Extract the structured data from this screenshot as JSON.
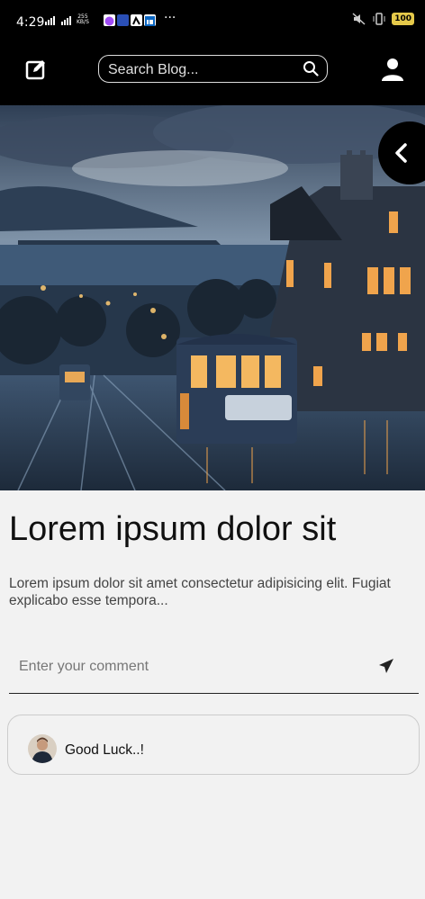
{
  "status_bar": {
    "time": "4:29",
    "net_speed_value": "255",
    "net_speed_unit": "KB/S",
    "network_type": "4G",
    "battery": "100"
  },
  "navbar": {
    "search_placeholder": "Search Blog..."
  },
  "post": {
    "title": "Lorem ipsum dolor sit",
    "description": "Lorem ipsum dolor sit amet consectetur adipisicing elit. Fugiat explicabo esse tempora..."
  },
  "comment_input": {
    "placeholder": "Enter your comment",
    "value": ""
  },
  "comments": [
    {
      "text": "Good Luck..!"
    }
  ],
  "colors": {
    "navbar_bg": "#000000",
    "page_bg": "#f2f2f2",
    "text": "#111111"
  }
}
